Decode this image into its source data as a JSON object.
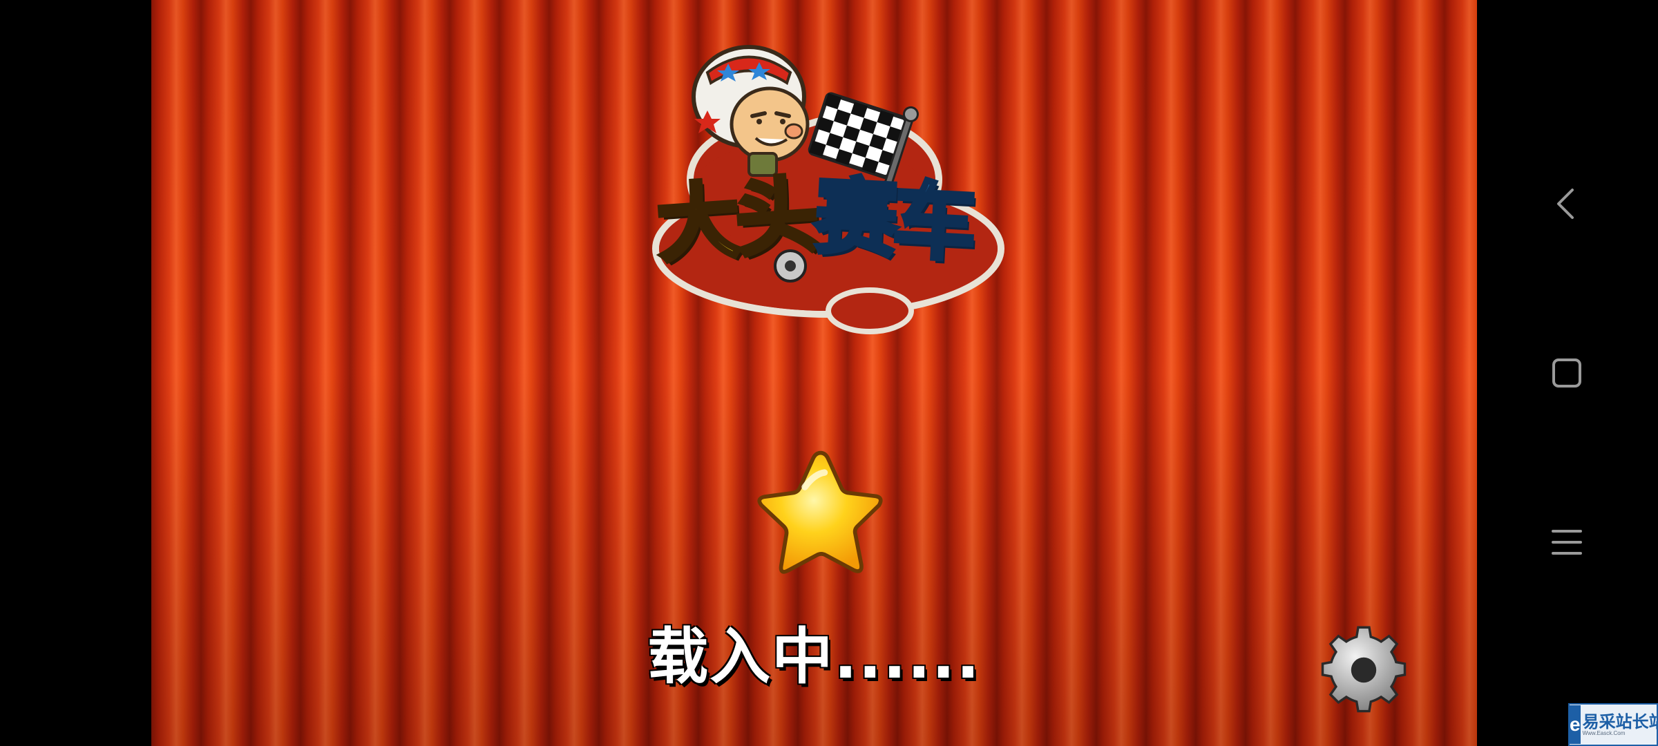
{
  "game": {
    "title_part1": "大头",
    "title_part2": "赛车",
    "loading_text": "载入中......"
  },
  "icons": {
    "settings": "gear-icon",
    "loading_indicator": "star-icon",
    "flag": "checkered-flag-icon",
    "mascot": "helmet-kid-mascot"
  },
  "system_nav": {
    "back": "back-icon",
    "home": "home-square-icon",
    "recents": "menu-lines-icon"
  },
  "watermark": {
    "logo_letter": "e",
    "title": "易采站长站",
    "url": "Www.Easck.Com"
  },
  "colors": {
    "curtain_red": "#dd3a12",
    "title_yellow": "#ffe21a",
    "title_blue": "#32a9f0",
    "star_gold": "#ffc21a"
  }
}
